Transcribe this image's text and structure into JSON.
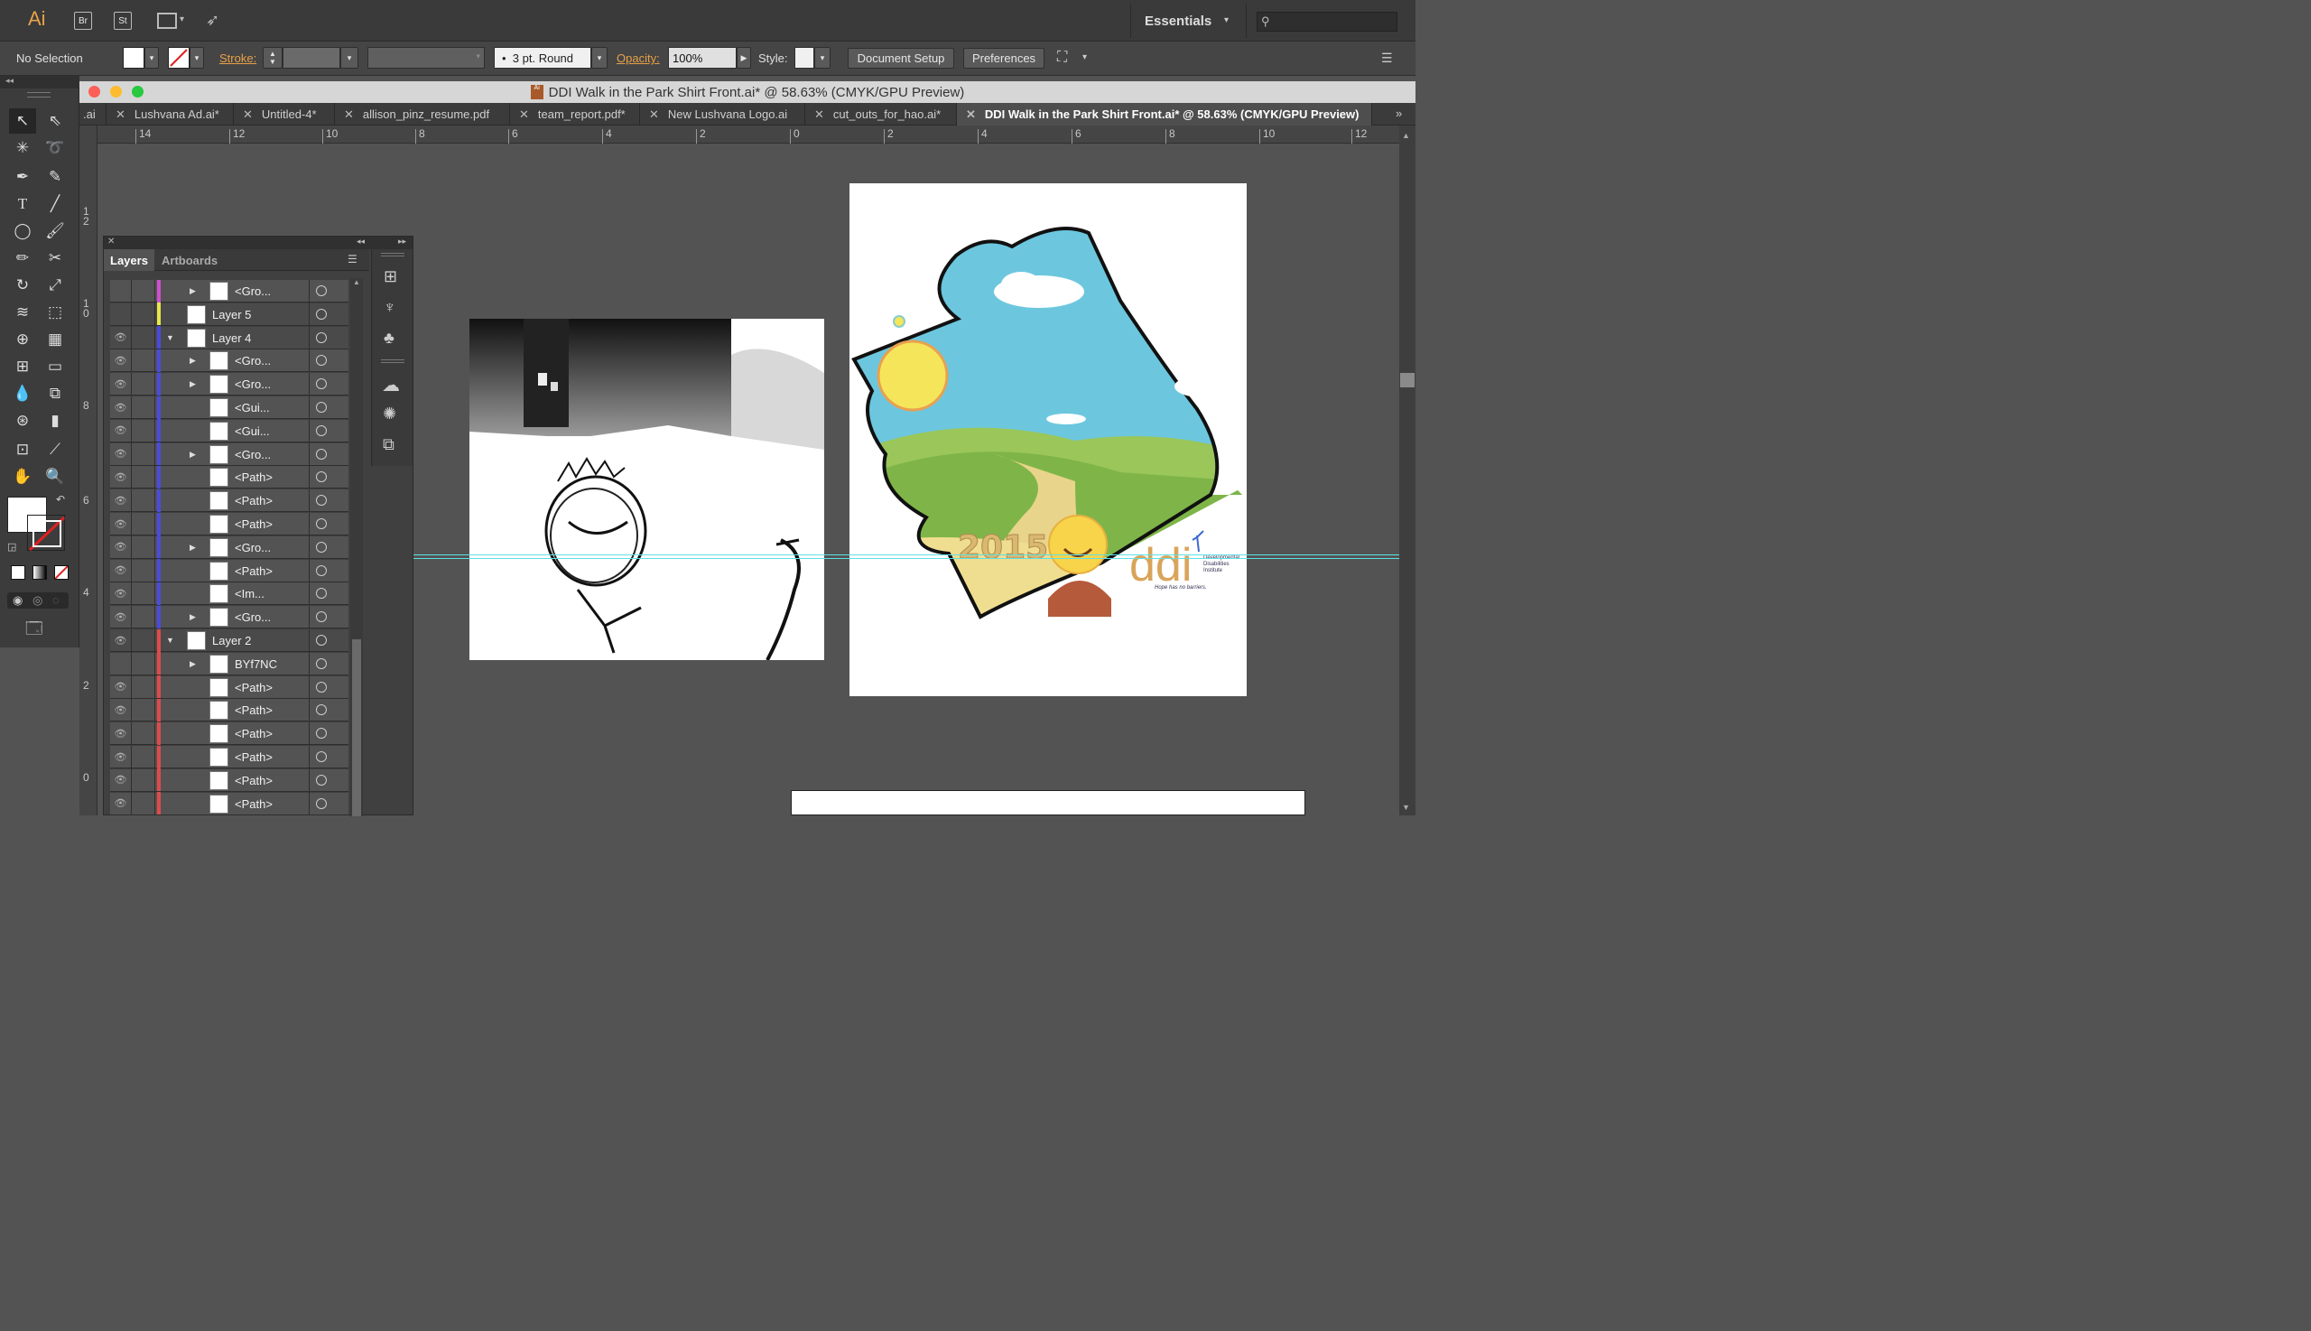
{
  "app": {
    "logo": "Ai",
    "br": "Br",
    "st": "St",
    "workspace": "Essentials"
  },
  "control": {
    "selection": "No Selection",
    "stroke_label": "Stroke:",
    "brush": "3 pt. Round",
    "opacity_label": "Opacity:",
    "opacity_value": "100%",
    "style_label": "Style:",
    "doc_setup": "Document Setup",
    "preferences": "Preferences"
  },
  "window": {
    "title": "DDI Walk in the Park Shirt Front.ai* @ 58.63% (CMYK/GPU Preview)"
  },
  "tabs": [
    {
      "label": ".ai",
      "active": false
    },
    {
      "label": "Lushvana Ad.ai*",
      "active": false
    },
    {
      "label": "Untitled-4*",
      "active": false
    },
    {
      "label": "allison_pinz_resume.pdf",
      "active": false
    },
    {
      "label": "team_report.pdf*",
      "active": false
    },
    {
      "label": "New Lushvana Logo.ai",
      "active": false
    },
    {
      "label": "cut_outs_for_hao.ai*",
      "active": false
    },
    {
      "label": "DDI Walk in the Park Shirt Front.ai* @ 58.63% (CMYK/GPU Preview)",
      "active": true
    }
  ],
  "ruler_h": [
    "14",
    "12",
    "10",
    "8",
    "6",
    "4",
    "2",
    "0",
    "2",
    "4",
    "6",
    "8",
    "10",
    "12"
  ],
  "ruler_v": [
    "1\n2",
    "1\n0",
    "8",
    "6",
    "4",
    "2",
    "0"
  ],
  "layers_panel": {
    "tab_layers": "Layers",
    "tab_artboards": "Artboards",
    "rows": [
      {
        "name": "<Gro...",
        "level": 1,
        "eye": false,
        "expand": "collapsed",
        "color": "#d04fd0"
      },
      {
        "name": "Layer 5",
        "level": 0,
        "eye": false,
        "expand": "none",
        "color": "#e8e84a"
      },
      {
        "name": "Layer 4",
        "level": 0,
        "eye": true,
        "expand": "expanded",
        "color": "#4a4ae0"
      },
      {
        "name": "<Gro...",
        "level": 1,
        "eye": true,
        "expand": "collapsed",
        "color": "#4a4ae0"
      },
      {
        "name": "<Gro...",
        "level": 1,
        "eye": true,
        "expand": "collapsed",
        "color": "#4a4ae0"
      },
      {
        "name": "<Gui...",
        "level": 1,
        "eye": true,
        "expand": "none",
        "color": "#4a4ae0"
      },
      {
        "name": "<Gui...",
        "level": 1,
        "eye": true,
        "expand": "none",
        "color": "#4a4ae0"
      },
      {
        "name": "<Gro...",
        "level": 1,
        "eye": true,
        "expand": "collapsed",
        "color": "#4a4ae0"
      },
      {
        "name": "<Path>",
        "level": 1,
        "eye": true,
        "expand": "none",
        "color": "#4a4ae0"
      },
      {
        "name": "<Path>",
        "level": 1,
        "eye": true,
        "expand": "none",
        "color": "#4a4ae0"
      },
      {
        "name": "<Path>",
        "level": 1,
        "eye": true,
        "expand": "none",
        "color": "#4a4ae0"
      },
      {
        "name": "<Gro...",
        "level": 1,
        "eye": true,
        "expand": "collapsed",
        "color": "#4a4ae0"
      },
      {
        "name": "<Path>",
        "level": 1,
        "eye": true,
        "expand": "none",
        "color": "#4a4ae0"
      },
      {
        "name": "<Im...",
        "level": 1,
        "eye": true,
        "expand": "none",
        "color": "#4a4ae0"
      },
      {
        "name": "<Gro...",
        "level": 1,
        "eye": true,
        "expand": "collapsed",
        "color": "#4a4ae0"
      },
      {
        "name": "Layer 2",
        "level": 0,
        "eye": true,
        "expand": "expanded",
        "color": "#e04a4a"
      },
      {
        "name": "BYf7NC",
        "level": 1,
        "eye": false,
        "expand": "collapsed",
        "color": "#e04a4a"
      },
      {
        "name": "<Path>",
        "level": 1,
        "eye": true,
        "expand": "none",
        "color": "#e04a4a"
      },
      {
        "name": "<Path>",
        "level": 1,
        "eye": true,
        "expand": "none",
        "color": "#e04a4a"
      },
      {
        "name": "<Path>",
        "level": 1,
        "eye": true,
        "expand": "none",
        "color": "#e04a4a"
      },
      {
        "name": "<Path>",
        "level": 1,
        "eye": true,
        "expand": "none",
        "color": "#e04a4a"
      },
      {
        "name": "<Path>",
        "level": 1,
        "eye": true,
        "expand": "none",
        "color": "#e04a4a"
      },
      {
        "name": "<Path>",
        "level": 1,
        "eye": true,
        "expand": "none",
        "color": "#e04a4a"
      }
    ]
  },
  "artwork": {
    "year_text": "2015",
    "logo_text": "ddi",
    "logo_sub1": "Developmental",
    "logo_sub2": "Disabilities",
    "logo_sub3": "Institute",
    "tagline": "Hope has no barriers."
  }
}
